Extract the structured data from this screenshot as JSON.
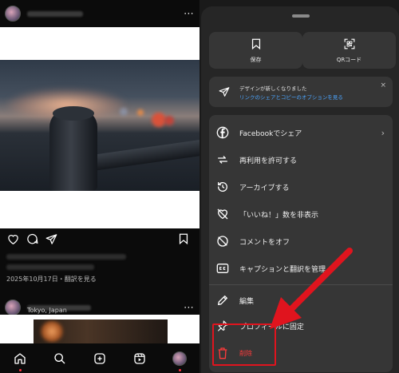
{
  "feed": {
    "post1": {
      "more_label": "⋯"
    },
    "post1_date": "2025年10月17日・翻訳を見る",
    "post2": {
      "location": "Tokyo, Japan",
      "more_label": "⋯"
    }
  },
  "nav": {
    "items": [
      "home-icon",
      "search-icon",
      "create-icon",
      "reels-icon",
      "profile-icon"
    ]
  },
  "sheet": {
    "tiles": [
      {
        "label": "保存",
        "icon": "bookmark-icon"
      },
      {
        "label": "QRコード",
        "icon": "qr-code-icon"
      }
    ],
    "notice": {
      "line1": "デザインが新しくなりました",
      "line2": "リンクのシェアとコピーのオプションを見る",
      "close": "×"
    },
    "menu": [
      {
        "label": "Facebookでシェア",
        "icon": "facebook-icon",
        "chevron": "›"
      },
      {
        "label": "再利用を許可する",
        "icon": "remix-icon"
      },
      {
        "label": "アーカイブする",
        "icon": "archive-icon"
      },
      {
        "label": "「いいね！」数を非表示",
        "icon": "hide-likes-icon"
      },
      {
        "label": "コメントをオフ",
        "icon": "comments-off-icon"
      },
      {
        "label": "キャプションと翻訳を管理",
        "icon": "captions-icon"
      },
      {
        "label": "編集",
        "icon": "pencil-icon"
      },
      {
        "label": "プロフィールに固定",
        "icon": "pin-icon"
      },
      {
        "label": "削除",
        "icon": "trash-icon"
      }
    ]
  },
  "colors": {
    "danger": "#ff3b3b",
    "link": "#4ca5ff",
    "annotation": "#e0141e"
  }
}
